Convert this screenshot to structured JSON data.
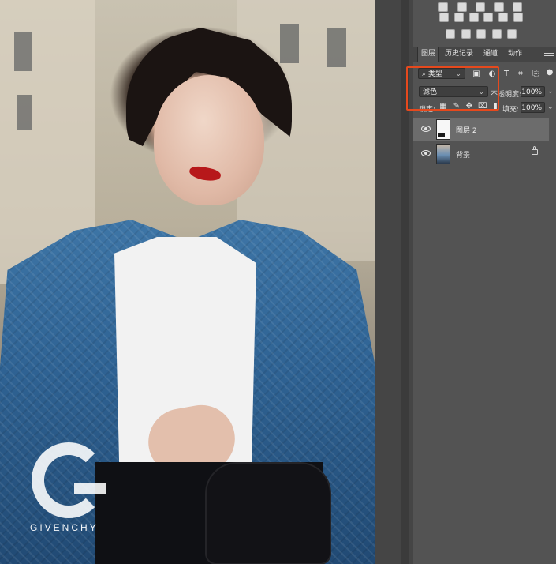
{
  "canvas": {
    "watermark_text": "GIVENCHY"
  },
  "layers_panel": {
    "tabs": [
      {
        "label": "图层"
      },
      {
        "label": "历史记录"
      },
      {
        "label": "通道"
      },
      {
        "label": "动作"
      }
    ],
    "filter": {
      "type_label": "类型",
      "type_chevron": "⌄"
    },
    "blend_mode": {
      "value": "滤色",
      "chevron": "⌄"
    },
    "opacity": {
      "label": "不透明度:",
      "value": "100%",
      "chevron": "⌄"
    },
    "lock": {
      "label": "锁定:"
    },
    "fill": {
      "label": "填充:",
      "value": "100%",
      "chevron": "⌄"
    },
    "layers": [
      {
        "name": "图层 2"
      },
      {
        "name": "背景"
      }
    ]
  },
  "icons": {
    "filter_icons": [
      "image-filter-icon",
      "adjustment-filter-icon",
      "type-filter-icon",
      "shape-filter-icon",
      "smart-object-filter-icon",
      "pixel-filter-dot-icon"
    ],
    "lock_icons": [
      "lock-transparent-pixels-icon",
      "lock-image-pixels-icon",
      "lock-position-icon",
      "lock-artboard-icon",
      "lock-all-icon"
    ],
    "adjustments_icons": [
      "brightness-contrast-icon",
      "levels-icon",
      "curves-icon",
      "exposure-icon",
      "vibrance-icon",
      "hue-saturation-icon",
      "color-balance-icon",
      "black-white-icon",
      "photo-filter-icon",
      "channel-mixer-icon",
      "color-lookup-icon",
      "invert-icon",
      "posterize-icon",
      "threshold-icon",
      "selective-color-icon",
      "gradient-map-icon"
    ]
  },
  "colors": {
    "highlight_box": "#e6491d",
    "panel_bg": "#535353"
  }
}
